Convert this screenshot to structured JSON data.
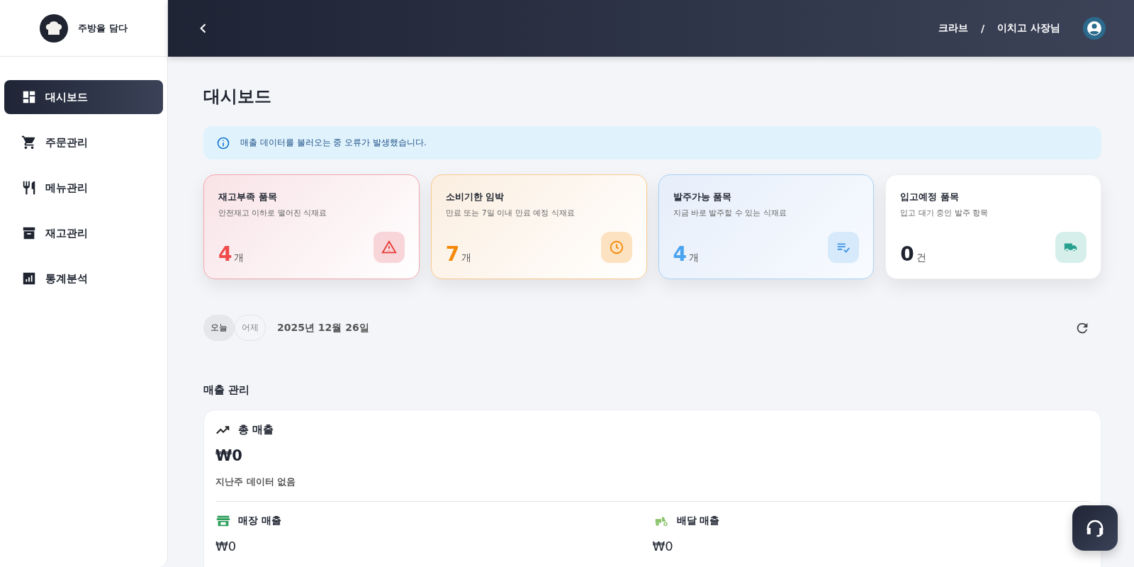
{
  "sidebar": {
    "brand": "주방을 담다",
    "items": [
      {
        "label": "대시보드",
        "kind": "dashboard",
        "selected": true
      },
      {
        "label": "주문관리",
        "kind": "cart",
        "selected": false
      },
      {
        "label": "메뉴관리",
        "kind": "utensils",
        "selected": false
      },
      {
        "label": "재고관리",
        "kind": "archive",
        "selected": false
      },
      {
        "label": "통계분석",
        "kind": "chart",
        "selected": false
      }
    ]
  },
  "header": {
    "store": "크라브",
    "separator": "/",
    "user": "이치고 사장님"
  },
  "page_title": "대시보드",
  "alert": {
    "message": "매출 데이터를 불러오는 중 오류가 발생했습니다."
  },
  "stat_cards": [
    {
      "kind": "danger",
      "title": "재고부족 품목",
      "subtitle": "안전재고 이하로 떨어진 식재료",
      "value": "4",
      "unit": "개"
    },
    {
      "kind": "warning",
      "title": "소비기한 임박",
      "subtitle": "만료 또는 7일 이내 만료 예정 식재료",
      "value": "7",
      "unit": "개"
    },
    {
      "kind": "info",
      "title": "발주가능 품목",
      "subtitle": "지금 바로 발주할 수 있는 식재료",
      "value": "4",
      "unit": "개"
    },
    {
      "kind": "neutral",
      "title": "입고예정 품목",
      "subtitle": "입고 대기 중인 발주 항목",
      "value": "0",
      "unit": "건"
    }
  ],
  "day_tabs": [
    {
      "label": "오늘",
      "selected": true
    },
    {
      "label": "어제",
      "selected": false
    }
  ],
  "date": "2025년 12월 26일",
  "sales": {
    "section_title": "매출 관리",
    "total_title": "총 매출",
    "total_value": "₩0",
    "total_note": "지난주 데이터 없음",
    "channels": [
      {
        "kind": "store",
        "title": "매장 매출",
        "value": "₩0"
      },
      {
        "kind": "delivery",
        "title": "배달 매출",
        "value": "₩0"
      }
    ]
  }
}
